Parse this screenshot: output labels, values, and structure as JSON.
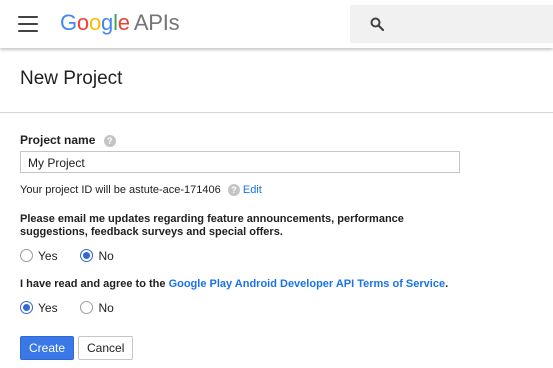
{
  "header": {
    "logo": {
      "G": "G",
      "o1": "o",
      "o2": "o",
      "g": "g",
      "l": "l",
      "e": "e",
      "apis": "APIs"
    },
    "menu_icon": "hamburger-icon",
    "search_icon": "search-icon"
  },
  "page": {
    "title": "New Project"
  },
  "form": {
    "project_name_label": "Project name",
    "project_name_value": "My Project",
    "project_id_text": "Your project ID will be astute-ace-171406",
    "edit_link": "Edit",
    "email_question_line1": "Please email me updates regarding feature announcements, performance",
    "email_question_line2": "suggestions, feedback surveys and special offers.",
    "email_options": [
      {
        "label": "Yes",
        "selected": false
      },
      {
        "label": "No",
        "selected": true
      }
    ],
    "terms_prefix": "I have read and agree to the ",
    "terms_link": "Google Play Android Developer API Terms of Service",
    "terms_suffix": ".",
    "terms_options": [
      {
        "label": "Yes",
        "selected": true
      },
      {
        "label": "No",
        "selected": false
      }
    ],
    "create_label": "Create",
    "cancel_label": "Cancel"
  },
  "colors": {
    "accent": "#3367d6",
    "link": "#1a73e8",
    "primary_button": "#3b78e7"
  }
}
